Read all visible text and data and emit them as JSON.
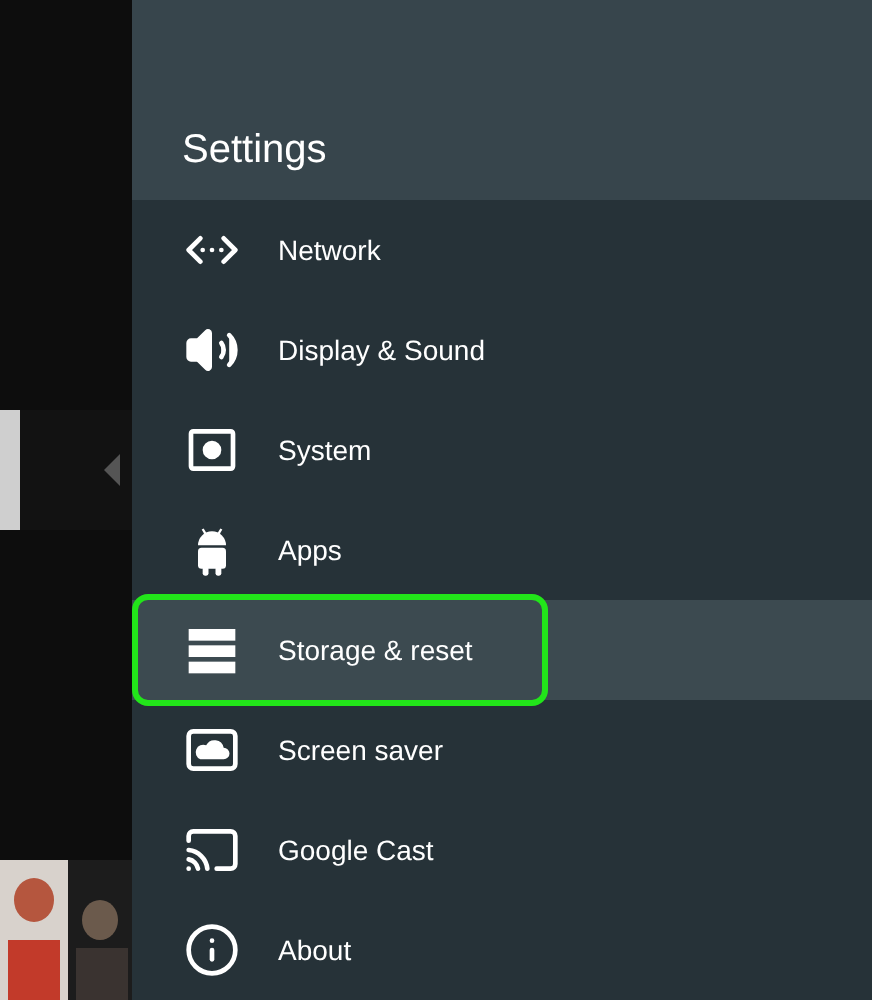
{
  "panel": {
    "title": "Settings"
  },
  "items": [
    {
      "kind": "network",
      "label": "Network",
      "selected": false,
      "highlighted": false
    },
    {
      "kind": "sound",
      "label": "Display & Sound",
      "selected": false,
      "highlighted": false
    },
    {
      "kind": "system",
      "label": "System",
      "selected": false,
      "highlighted": false
    },
    {
      "kind": "apps",
      "label": "Apps",
      "selected": false,
      "highlighted": false
    },
    {
      "kind": "storage",
      "label": "Storage & reset",
      "selected": true,
      "highlighted": true
    },
    {
      "kind": "screensaver",
      "label": "Screen saver",
      "selected": false,
      "highlighted": false
    },
    {
      "kind": "cast",
      "label": "Google Cast",
      "selected": false,
      "highlighted": false
    },
    {
      "kind": "about",
      "label": "About",
      "selected": false,
      "highlighted": false
    }
  ]
}
